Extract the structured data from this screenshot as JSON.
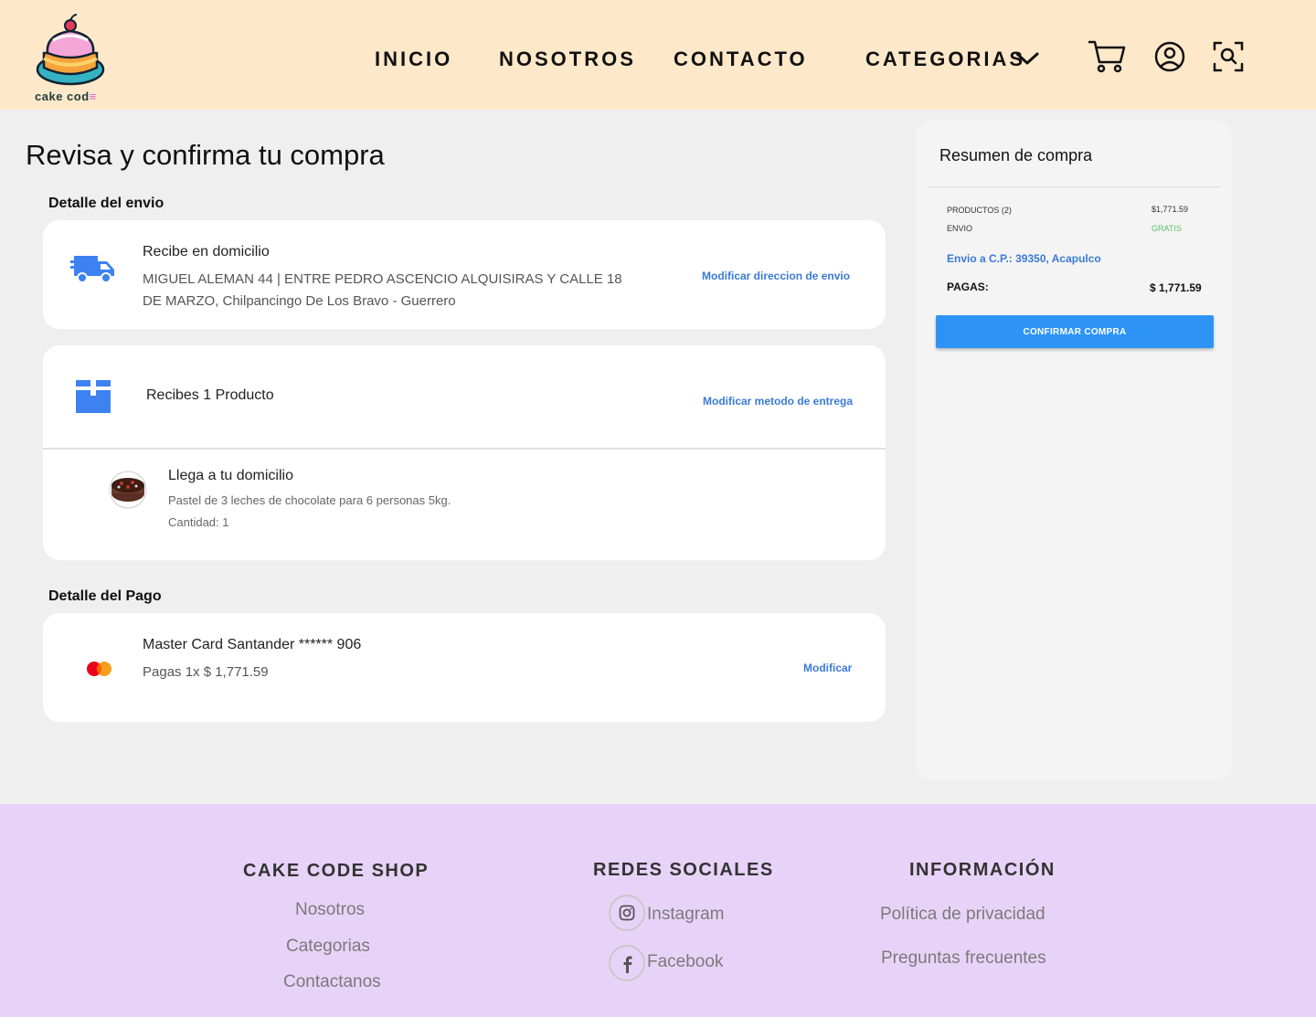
{
  "header": {
    "logo_text": "cake cod",
    "nav": {
      "inicio": "INICIO",
      "nosotros": "NOSOTROS",
      "contacto": "CONTACTO",
      "categorias": "CATEGORIAS"
    }
  },
  "main": {
    "title": "Revisa y confirma tu compra",
    "shipping": {
      "section_label": "Detalle del envio",
      "heading": "Recibe en domicilio",
      "address_line1": "MIGUEL ALEMAN 44 | ENTRE PEDRO ASCENCIO ALQUISIRAS Y CALLE 18",
      "address_line2": "DE MARZO, Chilpancingo De Los Bravo - Guerrero",
      "modify_label": "Modificar direccion de envio"
    },
    "product": {
      "heading": "Recibes 1 Producto",
      "modify_label": "Modificar metodo de entrega",
      "delivery_heading": "Llega a tu domicilio",
      "name": "Pastel de 3 leches de chocolate para 6 personas 5kg.",
      "quantity": "Cantidad: 1"
    },
    "payment": {
      "section_label": "Detalle del Pago",
      "card": "Master Card Santander ****** 906",
      "plan": "Pagas 1x $ 1,771.59",
      "modify_label": "Modificar"
    }
  },
  "summary": {
    "title": "Resumen de compra",
    "products_label": "PRODUCTOS (2)",
    "products_value": "$1,771.59",
    "shipping_label": "ENVIO",
    "shipping_value": "GRATIS",
    "shipping_to": "Envio a C.P.: 39350, Acapulco",
    "total_label": "PAGAS:",
    "total_value": "$ 1,771.59",
    "confirm_label": "CONFIRMAR COMPRA"
  },
  "footer": {
    "shop": {
      "heading": "CAKE CODE SHOP",
      "links": [
        "Nosotros",
        "Categorias",
        "Contactanos"
      ]
    },
    "social": {
      "heading": "REDES SOCIALES",
      "links": [
        "Instagram",
        "Facebook"
      ]
    },
    "info": {
      "heading": "INFORMACIÓN",
      "links": [
        "Política de privacidad",
        "Preguntas frecuentes"
      ]
    }
  },
  "colors": {
    "header_bg": "#fde9c9",
    "footer_bg": "#e8d3f8",
    "accent_blue": "#3a7bd5",
    "button_blue": "#2d94f5",
    "free_green": "#5cc16b"
  },
  "icons": [
    "cake-logo-icon",
    "chevron-down-icon",
    "cart-icon",
    "user-icon",
    "search-icon",
    "truck-icon",
    "box-icon",
    "mastercard-icon",
    "instagram-icon",
    "facebook-icon"
  ]
}
